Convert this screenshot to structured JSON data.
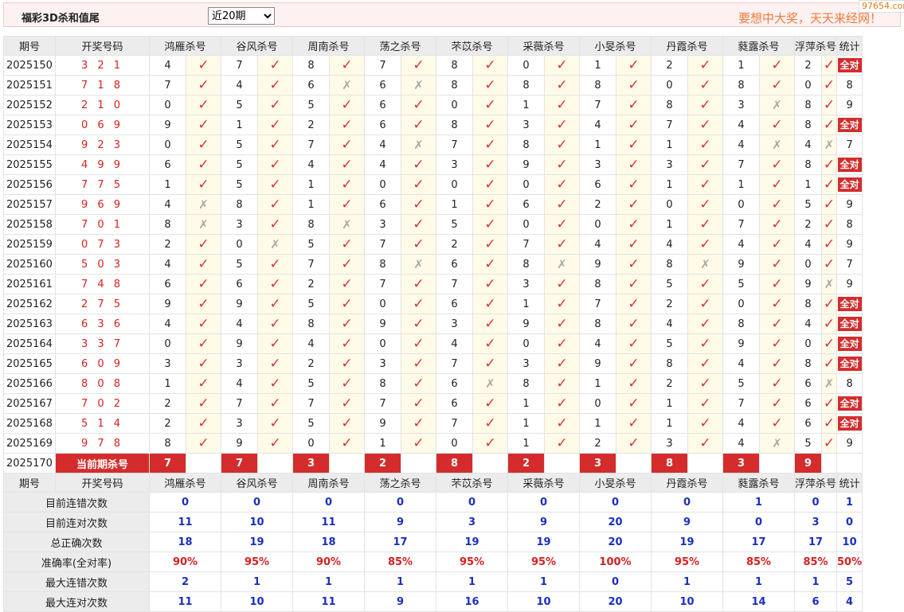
{
  "header": {
    "title": "福彩3D杀和值尾",
    "period_select": "近20期",
    "slogan": "要想中大奖，天天来经网！",
    "watermark": "97654.com"
  },
  "columns": {
    "period": "期号",
    "number": "开奖号码",
    "experts": [
      "鸿雁杀号",
      "谷风杀号",
      "周南杀号",
      "荡之杀号",
      "芣苡杀号",
      "采薇杀号",
      "小旻杀号",
      "丹霞杀号",
      "蕤露杀号",
      "浮萍杀号"
    ],
    "stats": "统计"
  },
  "rows": [
    {
      "period": "2025150",
      "number": "3 2 1",
      "kills": [
        4,
        7,
        8,
        7,
        8,
        0,
        1,
        2,
        1,
        2
      ],
      "results": [
        1,
        1,
        1,
        1,
        1,
        1,
        1,
        1,
        1,
        1
      ],
      "stat": "全对"
    },
    {
      "period": "2025151",
      "number": "7 1 8",
      "kills": [
        7,
        4,
        6,
        6,
        8,
        8,
        8,
        0,
        8,
        0
      ],
      "results": [
        1,
        1,
        0,
        0,
        1,
        1,
        1,
        1,
        1,
        1
      ],
      "stat": "8"
    },
    {
      "period": "2025152",
      "number": "2 1 0",
      "kills": [
        0,
        5,
        5,
        6,
        0,
        1,
        7,
        8,
        3,
        8
      ],
      "results": [
        1,
        1,
        1,
        1,
        1,
        1,
        1,
        1,
        0,
        1
      ],
      "stat": "9"
    },
    {
      "period": "2025153",
      "number": "0 6 9",
      "kills": [
        9,
        1,
        2,
        6,
        8,
        3,
        4,
        7,
        4,
        8
      ],
      "results": [
        1,
        1,
        1,
        1,
        1,
        1,
        1,
        1,
        1,
        1
      ],
      "stat": "全对"
    },
    {
      "period": "2025154",
      "number": "9 2 3",
      "kills": [
        0,
        5,
        7,
        4,
        7,
        8,
        1,
        1,
        4,
        4
      ],
      "results": [
        1,
        1,
        1,
        0,
        1,
        1,
        1,
        1,
        0,
        0
      ],
      "stat": "7"
    },
    {
      "period": "2025155",
      "number": "4 9 9",
      "kills": [
        6,
        5,
        4,
        4,
        3,
        9,
        3,
        3,
        7,
        8
      ],
      "results": [
        1,
        1,
        1,
        1,
        1,
        1,
        1,
        1,
        1,
        1
      ],
      "stat": "全对"
    },
    {
      "period": "2025156",
      "number": "7 7 5",
      "kills": [
        1,
        5,
        1,
        0,
        0,
        0,
        6,
        1,
        1,
        1
      ],
      "results": [
        1,
        1,
        1,
        1,
        1,
        1,
        1,
        1,
        1,
        1
      ],
      "stat": "全对"
    },
    {
      "period": "2025157",
      "number": "9 6 9",
      "kills": [
        4,
        8,
        1,
        6,
        1,
        6,
        2,
        0,
        0,
        5
      ],
      "results": [
        0,
        1,
        1,
        1,
        1,
        1,
        1,
        1,
        1,
        1
      ],
      "stat": "9"
    },
    {
      "period": "2025158",
      "number": "7 0 1",
      "kills": [
        8,
        3,
        8,
        3,
        5,
        0,
        0,
        1,
        7,
        2
      ],
      "results": [
        0,
        1,
        0,
        1,
        1,
        1,
        1,
        1,
        1,
        1
      ],
      "stat": "8"
    },
    {
      "period": "2025159",
      "number": "0 7 3",
      "kills": [
        2,
        0,
        5,
        7,
        2,
        7,
        4,
        4,
        4,
        4
      ],
      "results": [
        1,
        0,
        1,
        1,
        1,
        1,
        1,
        1,
        1,
        1
      ],
      "stat": "9"
    },
    {
      "period": "2025160",
      "number": "5 0 3",
      "kills": [
        4,
        5,
        7,
        8,
        6,
        8,
        9,
        8,
        9,
        0
      ],
      "results": [
        1,
        1,
        1,
        0,
        1,
        0,
        1,
        0,
        1,
        1
      ],
      "stat": "7"
    },
    {
      "period": "2025161",
      "number": "7 4 8",
      "kills": [
        6,
        6,
        2,
        7,
        7,
        3,
        8,
        5,
        5,
        9
      ],
      "results": [
        1,
        1,
        1,
        1,
        1,
        1,
        1,
        1,
        1,
        0
      ],
      "stat": "9"
    },
    {
      "period": "2025162",
      "number": "2 7 5",
      "kills": [
        9,
        9,
        5,
        0,
        6,
        1,
        7,
        2,
        0,
        8
      ],
      "results": [
        1,
        1,
        1,
        1,
        1,
        1,
        1,
        1,
        1,
        1
      ],
      "stat": "全对"
    },
    {
      "period": "2025163",
      "number": "6 3 6",
      "kills": [
        4,
        4,
        8,
        9,
        3,
        9,
        8,
        4,
        8,
        4
      ],
      "results": [
        1,
        1,
        1,
        1,
        1,
        1,
        1,
        1,
        1,
        1
      ],
      "stat": "全对"
    },
    {
      "period": "2025164",
      "number": "3 3 7",
      "kills": [
        0,
        9,
        4,
        0,
        4,
        0,
        4,
        5,
        9,
        0
      ],
      "results": [
        1,
        1,
        1,
        1,
        1,
        1,
        1,
        1,
        1,
        1
      ],
      "stat": "全对"
    },
    {
      "period": "2025165",
      "number": "6 0 9",
      "kills": [
        3,
        3,
        2,
        3,
        7,
        3,
        9,
        8,
        4,
        8
      ],
      "results": [
        1,
        1,
        1,
        1,
        1,
        1,
        1,
        1,
        1,
        1
      ],
      "stat": "全对"
    },
    {
      "period": "2025166",
      "number": "8 0 8",
      "kills": [
        1,
        4,
        5,
        8,
        6,
        8,
        1,
        2,
        5,
        6
      ],
      "results": [
        1,
        1,
        1,
        1,
        0,
        1,
        1,
        1,
        1,
        0
      ],
      "stat": "8"
    },
    {
      "period": "2025167",
      "number": "7 0 2",
      "kills": [
        2,
        7,
        7,
        7,
        6,
        1,
        0,
        1,
        7,
        6
      ],
      "results": [
        1,
        1,
        1,
        1,
        1,
        1,
        1,
        1,
        1,
        1
      ],
      "stat": "全对"
    },
    {
      "period": "2025168",
      "number": "5 1 4",
      "kills": [
        2,
        3,
        5,
        9,
        7,
        1,
        1,
        1,
        4,
        6
      ],
      "results": [
        1,
        1,
        1,
        1,
        1,
        1,
        1,
        1,
        1,
        1
      ],
      "stat": "全对"
    },
    {
      "period": "2025169",
      "number": "9 7 8",
      "kills": [
        8,
        9,
        0,
        1,
        0,
        1,
        2,
        3,
        4,
        5
      ],
      "results": [
        1,
        1,
        1,
        1,
        1,
        1,
        1,
        1,
        0,
        1
      ],
      "stat": "9"
    }
  ],
  "current": {
    "period": "2025170",
    "label": "当前期杀号",
    "kills": [
      "7",
      "7",
      "3",
      "2",
      "8",
      "2",
      "3",
      "8",
      "3",
      "9"
    ]
  },
  "stats": [
    {
      "label": "目前连错次数",
      "values": [
        "0",
        "0",
        "0",
        "0",
        "0",
        "0",
        "0",
        "0",
        "1",
        "0"
      ],
      "total": "1"
    },
    {
      "label": "目前连对次数",
      "values": [
        "11",
        "10",
        "11",
        "9",
        "3",
        "9",
        "20",
        "9",
        "0",
        "3"
      ],
      "total": "0"
    },
    {
      "label": "总正确次数",
      "values": [
        "18",
        "19",
        "18",
        "17",
        "19",
        "19",
        "20",
        "19",
        "17",
        "17"
      ],
      "total": "10"
    },
    {
      "label": "准确率(全对率)",
      "values": [
        "90%",
        "95%",
        "90%",
        "85%",
        "95%",
        "95%",
        "100%",
        "95%",
        "85%",
        "85%"
      ],
      "total": "50%"
    },
    {
      "label": "最大连错次数",
      "values": [
        "2",
        "1",
        "1",
        "1",
        "1",
        "1",
        "0",
        "1",
        "1",
        "1"
      ],
      "total": "5"
    },
    {
      "label": "最大连对次数",
      "values": [
        "11",
        "10",
        "11",
        "9",
        "16",
        "10",
        "20",
        "10",
        "14",
        "6"
      ],
      "total": "4"
    }
  ],
  "marks": {
    "ok": "✓",
    "bad": "✗"
  }
}
